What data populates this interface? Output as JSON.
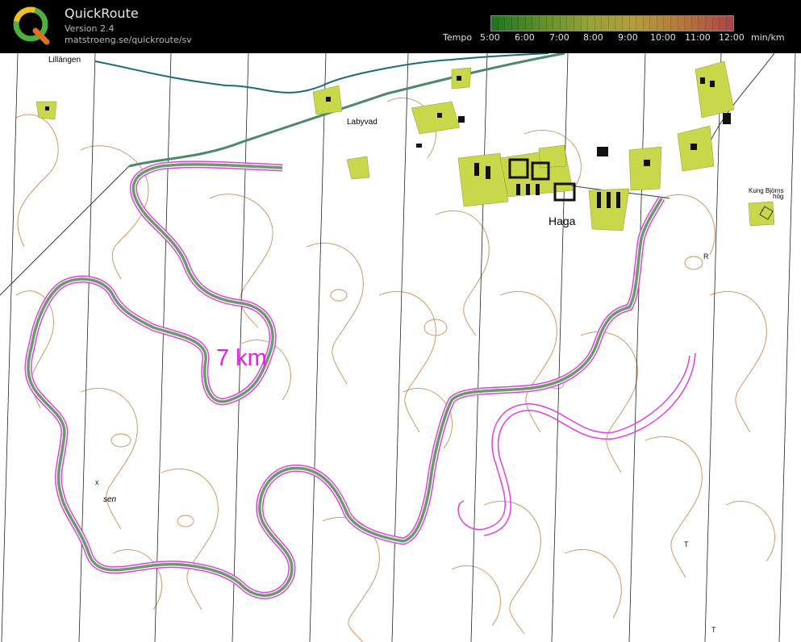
{
  "app": {
    "name": "QuickRoute",
    "version": "Version 2.4",
    "url": "matstroeng.se/quickroute/sv"
  },
  "tempo": {
    "label": "Tempo",
    "ticks": [
      "5:00",
      "6:00",
      "7:00",
      "8:00",
      "9:00",
      "10:00",
      "11:00",
      "12:00"
    ],
    "unit": "min/km",
    "colors": [
      "#2e9e2e",
      "#7fbf3a",
      "#c8d84a",
      "#f0d050",
      "#f0a050",
      "#e86060"
    ]
  },
  "map": {
    "labels": {
      "lillangen": "Lillängen",
      "labyvad": "Labyvad",
      "haga": "Haga",
      "kung_bjorns": "Kung Björns",
      "hog": "hög",
      "sen": "sen",
      "r": "R"
    },
    "distance_label": "7 km",
    "colors": {
      "contour": "#c87832",
      "route_fill": "#6a9a6a",
      "route_outline": "#e040e0",
      "water": "#1a6a7a",
      "settlement": "#c8d84a",
      "road": "#4a8a6a"
    }
  }
}
